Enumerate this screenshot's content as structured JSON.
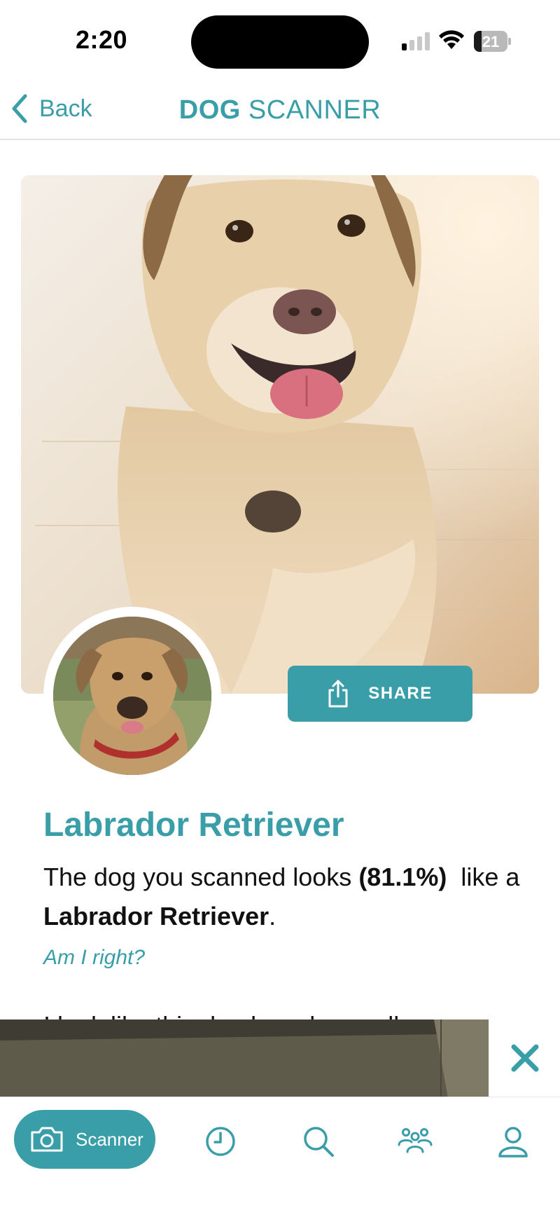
{
  "status_bar": {
    "time": "2:20",
    "battery": "21",
    "battery_level": 0.21
  },
  "nav": {
    "back_label": "Back",
    "title_bold": "DOG",
    "title_rest": " SCANNER"
  },
  "result": {
    "breed": "Labrador Retriever",
    "text_before": "The dog you scanned looks ",
    "confidence": "(81.1%)",
    "text_middle": "  like a ",
    "breed_inline": "Labrador Retriever",
    "text_after": ".",
    "question": "Am I right?",
    "cut_off_line": "I look like this dog breed as well: Labrador"
  },
  "share": {
    "label": "SHARE"
  },
  "tabbar": {
    "scanner_label": "Scanner",
    "items": [
      "history-icon",
      "search-icon",
      "community-icon",
      "profile-icon"
    ]
  },
  "colors": {
    "accent": "#3a9ea8"
  }
}
